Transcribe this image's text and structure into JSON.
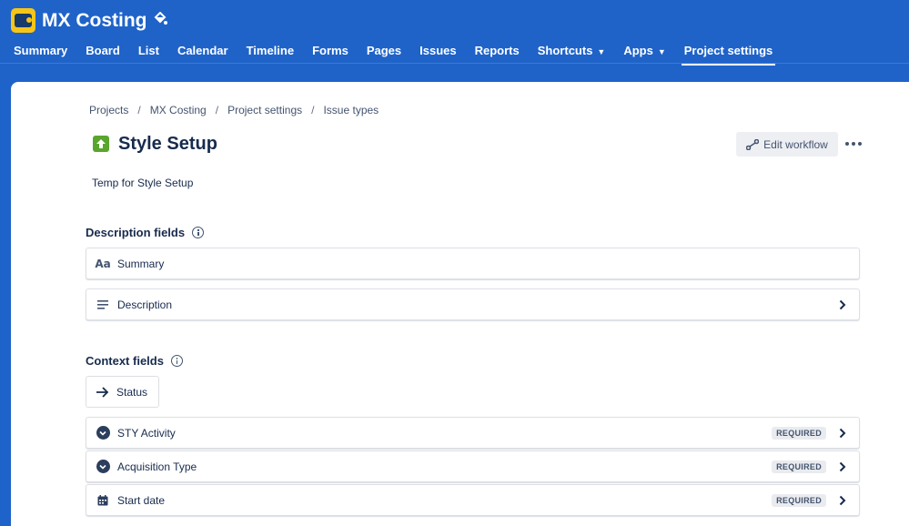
{
  "header": {
    "project_name": "MX Costing",
    "nav": [
      {
        "label": "Summary"
      },
      {
        "label": "Board"
      },
      {
        "label": "List"
      },
      {
        "label": "Calendar"
      },
      {
        "label": "Timeline"
      },
      {
        "label": "Forms"
      },
      {
        "label": "Pages"
      },
      {
        "label": "Issues"
      },
      {
        "label": "Reports"
      },
      {
        "label": "Shortcuts"
      },
      {
        "label": "Apps"
      },
      {
        "label": "Project settings"
      }
    ],
    "active_nav": "Project settings",
    "accent_color": "#1f63c9"
  },
  "breadcrumb": [
    "Projects",
    "MX Costing",
    "Project settings",
    "Issue types"
  ],
  "issue_type": {
    "name": "Style Setup",
    "description": "Temp for Style Setup",
    "icon": "arrow-up-icon",
    "icon_color": "#5aa52c"
  },
  "actions": {
    "edit_workflow": "Edit workflow",
    "more": "more-icon"
  },
  "description_fields": {
    "heading": "Description fields",
    "items": [
      {
        "label": "Summary",
        "icon": "text-icon",
        "icon_text": "Aa"
      },
      {
        "label": "Description",
        "icon": "lines-icon"
      }
    ]
  },
  "context_fields": {
    "heading": "Context fields",
    "status": {
      "label": "Status",
      "icon": "arrow-right-icon"
    },
    "items": [
      {
        "label": "STY Activity",
        "badge": "REQUIRED",
        "icon": "dropdown-icon"
      },
      {
        "label": "Acquisition Type",
        "badge": "REQUIRED",
        "icon": "dropdown-icon"
      },
      {
        "label": "Start date",
        "badge": "REQUIRED",
        "icon": "calendar-icon"
      }
    ]
  }
}
